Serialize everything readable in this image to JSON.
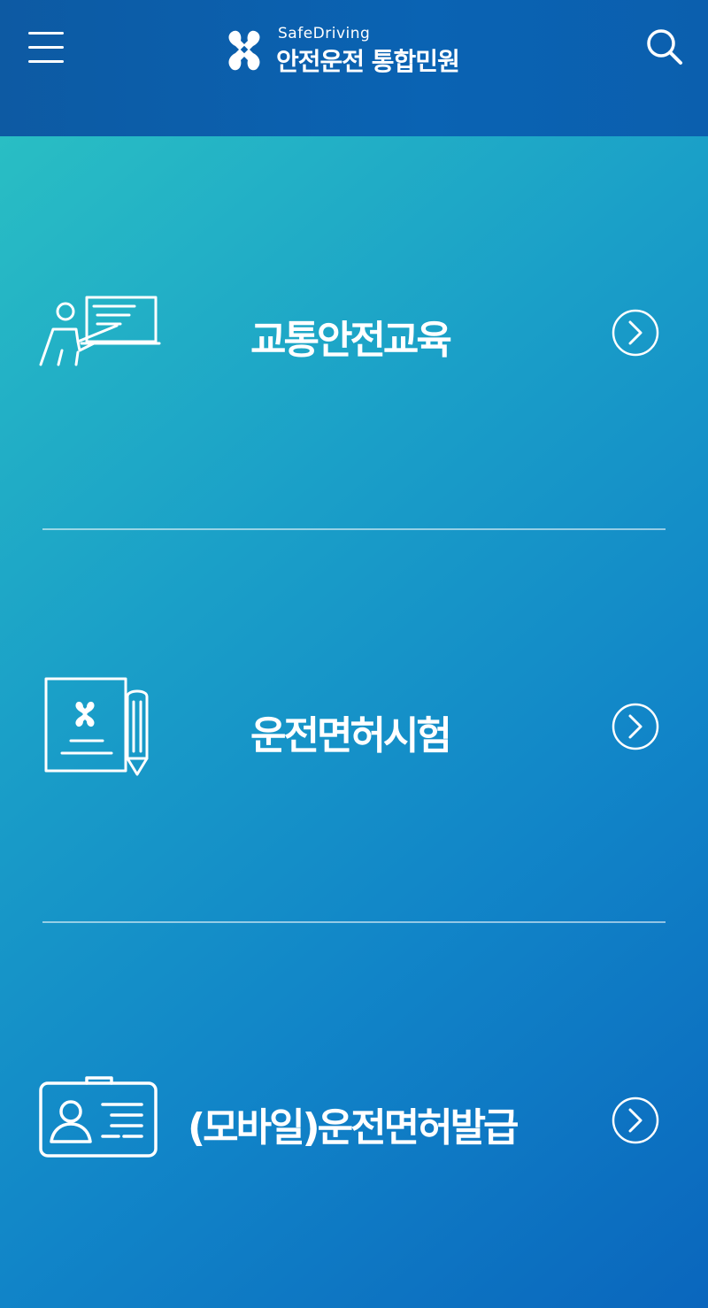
{
  "header": {
    "logo_sub": "SafeDriving",
    "logo_main": "안전운전 통합민원",
    "menu_icon": "hamburger-menu-icon",
    "search_icon": "search-icon",
    "background_color": "#0a5fae"
  },
  "menu": {
    "items": [
      {
        "label": "교통안전교육",
        "icon": "teacher-presentation-icon"
      },
      {
        "label": "운전면허시험",
        "icon": "exam-paper-pencil-icon"
      },
      {
        "label": "(모바일)운전면허발급",
        "icon": "id-card-icon"
      }
    ],
    "arrow_icon": "chevron-right-circle-icon"
  },
  "colors": {
    "gradient_start": "#29bec4",
    "gradient_end": "#0a66bd",
    "foreground": "#ffffff"
  }
}
